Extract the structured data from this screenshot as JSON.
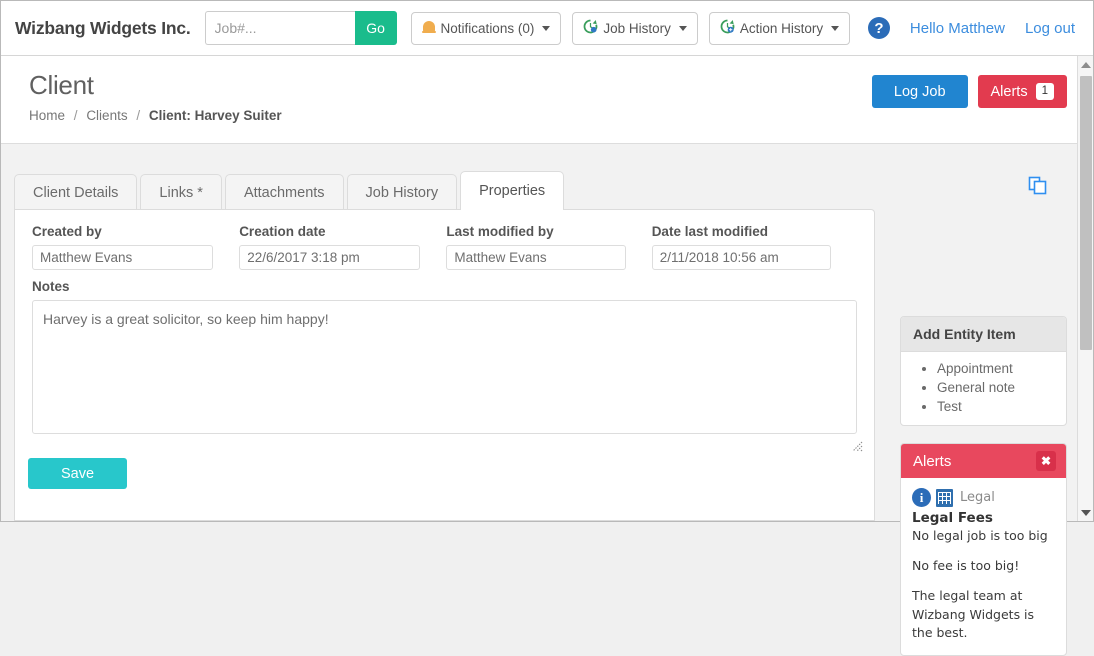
{
  "navbar": {
    "brand": "Wizbang Widgets Inc.",
    "search_placeholder": "Job#...",
    "search_value": "",
    "go_label": "Go",
    "notifications_label": "Notifications (0)",
    "job_history_label": "Job History",
    "action_history_label": "Action History",
    "help_glyph": "?",
    "greeting": "Hello Matthew",
    "logout_label": "Log out"
  },
  "page": {
    "title": "Client",
    "breadcrumb": {
      "home": "Home",
      "clients": "Clients",
      "current": "Client: Harvey Suiter",
      "separator": "/"
    },
    "log_job_label": "Log Job",
    "alerts_label": "Alerts",
    "alerts_count": "1"
  },
  "tabs": [
    {
      "label": "Client Details",
      "active": false
    },
    {
      "label": "Links *",
      "active": false
    },
    {
      "label": "Attachments",
      "active": false
    },
    {
      "label": "Job History",
      "active": false
    },
    {
      "label": "Properties",
      "active": true
    }
  ],
  "properties": {
    "fields": [
      {
        "label": "Created by",
        "value": "Matthew Evans"
      },
      {
        "label": "Creation date",
        "value": "22/6/2017 3:18 pm"
      },
      {
        "label": "Last modified by",
        "value": "Matthew Evans"
      },
      {
        "label": "Date last modified",
        "value": "2/11/2018 10:56 am"
      }
    ],
    "notes_label": "Notes",
    "notes_value": "Harvey is a great solicitor, so keep him happy!",
    "save_label": "Save"
  },
  "add_entity": {
    "title": "Add Entity Item",
    "items": [
      "Appointment",
      "General note",
      "Test"
    ]
  },
  "alerts_panel": {
    "title": "Alerts",
    "close_glyph": "✖",
    "info_glyph": "i",
    "category": "Legal",
    "heading": "Legal Fees",
    "paragraphs": [
      "No legal job is too big",
      "No fee is too big!",
      "The legal team at Wizbang Widgets is the best."
    ]
  },
  "colors": {
    "go_green": "#1abc8c",
    "primary_blue": "#2185d0",
    "alert_red": "#e23b4f",
    "save_teal": "#28c7cb",
    "link_blue": "#3c8dde",
    "bell_orange": "#f0ad4e"
  }
}
